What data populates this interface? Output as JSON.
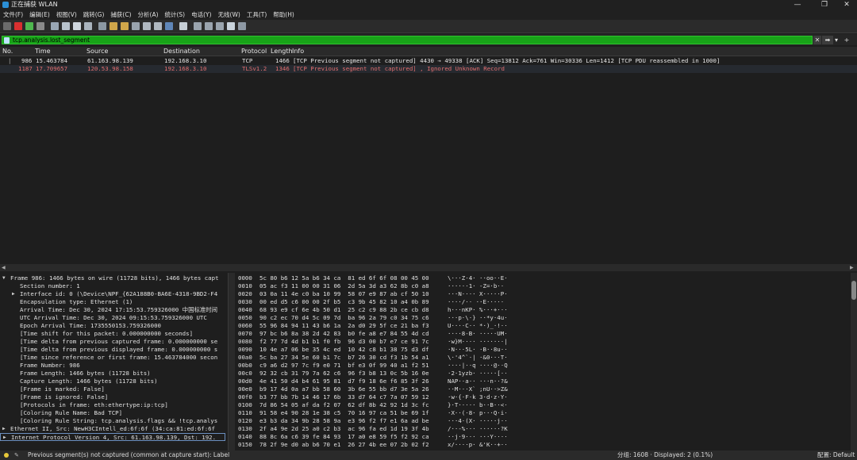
{
  "window": {
    "title": "正在捕获 WLAN",
    "min": "—",
    "max": "❐",
    "close": "✕"
  },
  "menu": [
    "文件(F)",
    "编辑(E)",
    "视图(V)",
    "跳转(G)",
    "捕获(C)",
    "分析(A)",
    "统计(S)",
    "电话(Y)",
    "无线(W)",
    "工具(T)",
    "帮助(H)"
  ],
  "filter": {
    "value": "tcp.analysis.lost_segment",
    "clear": "✕",
    "apply": "➡",
    "dropdown": "▾",
    "add": "+"
  },
  "packet_list": {
    "columns": {
      "no": "No.",
      "time": "Time",
      "source": "Source",
      "destination": "Destination",
      "protocol": "Protocol",
      "length": "Length",
      "info": "Info"
    },
    "rows": [
      {
        "no": "986",
        "time": "15.463784",
        "source": "61.163.98.139",
        "destination": "192.168.3.10",
        "protocol": "TCP",
        "length": "1466",
        "info": "[TCP Previous segment not captured] 4430 → 49338 [ACK] Seq=13812 Ack=761 Win=30336 Len=1412 [TCP PDU reassembled in 1000]"
      },
      {
        "no": "1187",
        "time": "17.709657",
        "source": "120.53.98.158",
        "destination": "192.168.3.10",
        "protocol": "TLSv1.2",
        "length": "1346",
        "info": "[TCP Previous segment not captured] , Ignored Unknown Record"
      }
    ]
  },
  "details": [
    "Frame 986: 1466 bytes on wire (11728 bits), 1466 bytes capt",
    "Section number: 1",
    "Interface id: 0 (\\Device\\NPF_{62A188B0-BA6E-4318-9BD2-F4",
    "Encapsulation type: Ethernet (1)",
    "Arrival Time: Dec 30, 2024 17:15:53.759326000 中国标准时间",
    "UTC Arrival Time: Dec 30, 2024 09:15:53.759326000 UTC",
    "Epoch Arrival Time: 1735550153.759326000",
    "[Time shift for this packet: 0.000000000 seconds]",
    "[Time delta from previous captured frame: 0.000000000 se",
    "[Time delta from previous displayed frame: 0.000000000 s",
    "[Time since reference or first frame: 15.463784000 secon",
    "Frame Number: 986",
    "Frame Length: 1466 bytes (11728 bits)",
    "Capture Length: 1466 bytes (11728 bits)",
    "[Frame is marked: False]",
    "[Frame is ignored: False]",
    "[Protocols in frame: eth:ethertype:ip:tcp]",
    "[Coloring Rule Name: Bad TCP]",
    "[Coloring Rule String: tcp.analysis.flags && !tcp.analys",
    "Ethernet II, Src: NewH3CIntell_ed:6f:6f (34:ca:81:ed:6f:6f",
    "Internet Protocol Version 4, Src: 61.163.98.139, Dst: 192."
  ],
  "bytes": [
    {
      "off": "0000",
      "hex": "5c 80 b6 12 5a b6 34 ca  81 ed 6f 6f 08 00 45 00",
      "ascii": "\\···Z·4· ··oo··E·"
    },
    {
      "off": "0010",
      "hex": "05 ac f3 11 00 00 31 06  2d 5a 3d a3 62 8b c0 a8",
      "ascii": "······1· -Z=·b··"
    },
    {
      "off": "0020",
      "hex": "03 0a 11 4e c0 ba 10 99  58 07 e9 87 ab cf 50 10",
      "ascii": "···N···· X·····P·"
    },
    {
      "off": "0030",
      "hex": "00 ed d5 c6 00 00 2f b5  c3 9b 45 82 10 a4 0b 89",
      "ascii": "····/·· ··E·····"
    },
    {
      "off": "0040",
      "hex": "68 93 e9 cf 6e 4b 50 d1  25 c2 c9 88 2b ce cb d8",
      "ascii": "h···nKP· %···+···"
    },
    {
      "off": "0050",
      "hex": "90 c2 ec 70 d4 5c 09 7d  ba 96 2a 79 c0 34 75 c6",
      "ascii": "···p·\\·} ··*y·4u·"
    },
    {
      "off": "0060",
      "hex": "55 96 84 94 11 43 b6 1a  2a d0 29 5f ce 21 ba f3",
      "ascii": "U····C·· *·)_·!··"
    },
    {
      "off": "0070",
      "hex": "97 bc b6 8a 38 2d 42 83  b0 fe a8 e7 84 55 4d cd",
      "ascii": "····8-B· ·····UM·"
    },
    {
      "off": "0080",
      "hex": "f2 77 7d 4d b1 b1 f0 fb  96 d3 00 b7 e7 ce 91 7c",
      "ascii": "·w}M···· ·······|"
    },
    {
      "off": "0090",
      "hex": "10 4e a7 06 be 35 4c ed  10 42 c8 b1 38 75 d3 df",
      "ascii": "·N···5L· ·B··8u··"
    },
    {
      "off": "00a0",
      "hex": "5c ba 27 34 5e 60 b1 7c  b7 26 30 cd f3 1b 54 a1",
      "ascii": "\\·'4^`·| ·&0···T·"
    },
    {
      "off": "00b0",
      "hex": "c9 a6 d2 97 7c f9 e0 71  bf e3 0f 99 40 a1 f2 51",
      "ascii": "····|··q ····@··Q"
    },
    {
      "off": "00c0",
      "hex": "92 32 cb 31 79 7a 62 c6  96 f3 b8 13 0c 5b 16 0e",
      "ascii": "·2·1yzb· ·····[··"
    },
    {
      "off": "00d0",
      "hex": "4e 41 50 d4 b4 61 95 81  d7 f9 18 6e f6 85 3f 26",
      "ascii": "NAP··a·· ···n··?&"
    },
    {
      "off": "00e0",
      "hex": "b9 17 4d 0a a7 bb 58 60  3b 6e 55 bb d7 3e 5a 26",
      "ascii": "··M···X` ;nU··>Z&"
    },
    {
      "off": "00f0",
      "hex": "b3 77 bb 7b 14 46 17 6b  33 d7 64 c7 7a 07 59 12",
      "ascii": "·w·{·F·k 3·d·z·Y·"
    },
    {
      "off": "0100",
      "hex": "7d 86 54 05 af da f2 07  62 df 8b 42 92 1d 3c fc",
      "ascii": "}·T····· b··B··<·"
    },
    {
      "off": "0110",
      "hex": "91 58 e4 90 28 1e 38 c5  70 16 97 ca 51 be 69 1f",
      "ascii": "·X··(·8· p···Q·i·"
    },
    {
      "off": "0120",
      "hex": "e3 b3 da 34 9b 28 58 9a  e3 96 f2 f7 e1 6a ad be",
      "ascii": "···4·(X· ·····j··"
    },
    {
      "off": "0130",
      "hex": "2f a4 9e 2d 25 a0 c2 b3  ac 96 fa ed 1d 19 3f 4b",
      "ascii": "/··-%··· ······?K"
    },
    {
      "off": "0140",
      "hex": "88 8c 6a c6 39 fe 84 93  17 a0 e8 59 f5 f2 92 ca",
      "ascii": "··j·9··· ···Y····"
    },
    {
      "off": "0150",
      "hex": "78 2f 9e d0 ab b6 70 e1  26 27 4b ee 07 2b 02 f2",
      "ascii": "x/····p· &'K··+··"
    }
  ],
  "status": {
    "message": "Previous segment(s) not captured (common at capture start): Label",
    "counts": "分组: 1608 · Displayed: 2 (0.1%)",
    "profile": "配置: Default"
  },
  "colors": {
    "filter_bg": "#18a318",
    "bad_tcp_text": "#e36f6f",
    "status_dot": "#e8c93a"
  }
}
